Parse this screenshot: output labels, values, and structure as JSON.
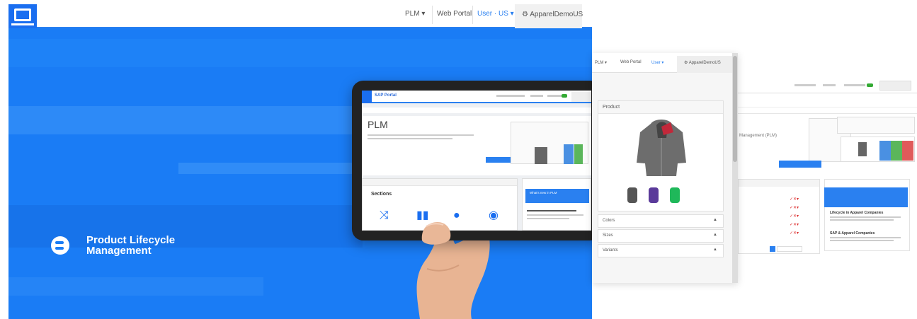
{
  "banner": {
    "nav": {
      "plm": "PLM ▾",
      "web_portal": "Web Portal",
      "user": "User · US ▾",
      "account": "⚙ ApparelDemoUS"
    },
    "product": {
      "line1": "Product Lifecycle",
      "line2": "Management"
    }
  },
  "tablet": {
    "brand": "SAP Portal",
    "plm": "PLM",
    "sections": "Sections",
    "news_title": "What's new in PLM"
  },
  "mobile": {
    "nav": {
      "plm": "PLM ▾",
      "web_portal": "Web Portal",
      "user": "User ▾",
      "account": "⚙ ApparelDemoUS"
    },
    "product_title": "Product",
    "accordion": [
      "Colors",
      "Sizes",
      "Variants"
    ]
  },
  "right_page": {
    "mgmt": "Management (PLM)",
    "news": [
      "Lifecycle in Apparel Companies",
      "SAP & Apparel Companies"
    ]
  },
  "colors": {
    "brand_blue": "#1a7cf5",
    "accent": "#2a80f0"
  }
}
